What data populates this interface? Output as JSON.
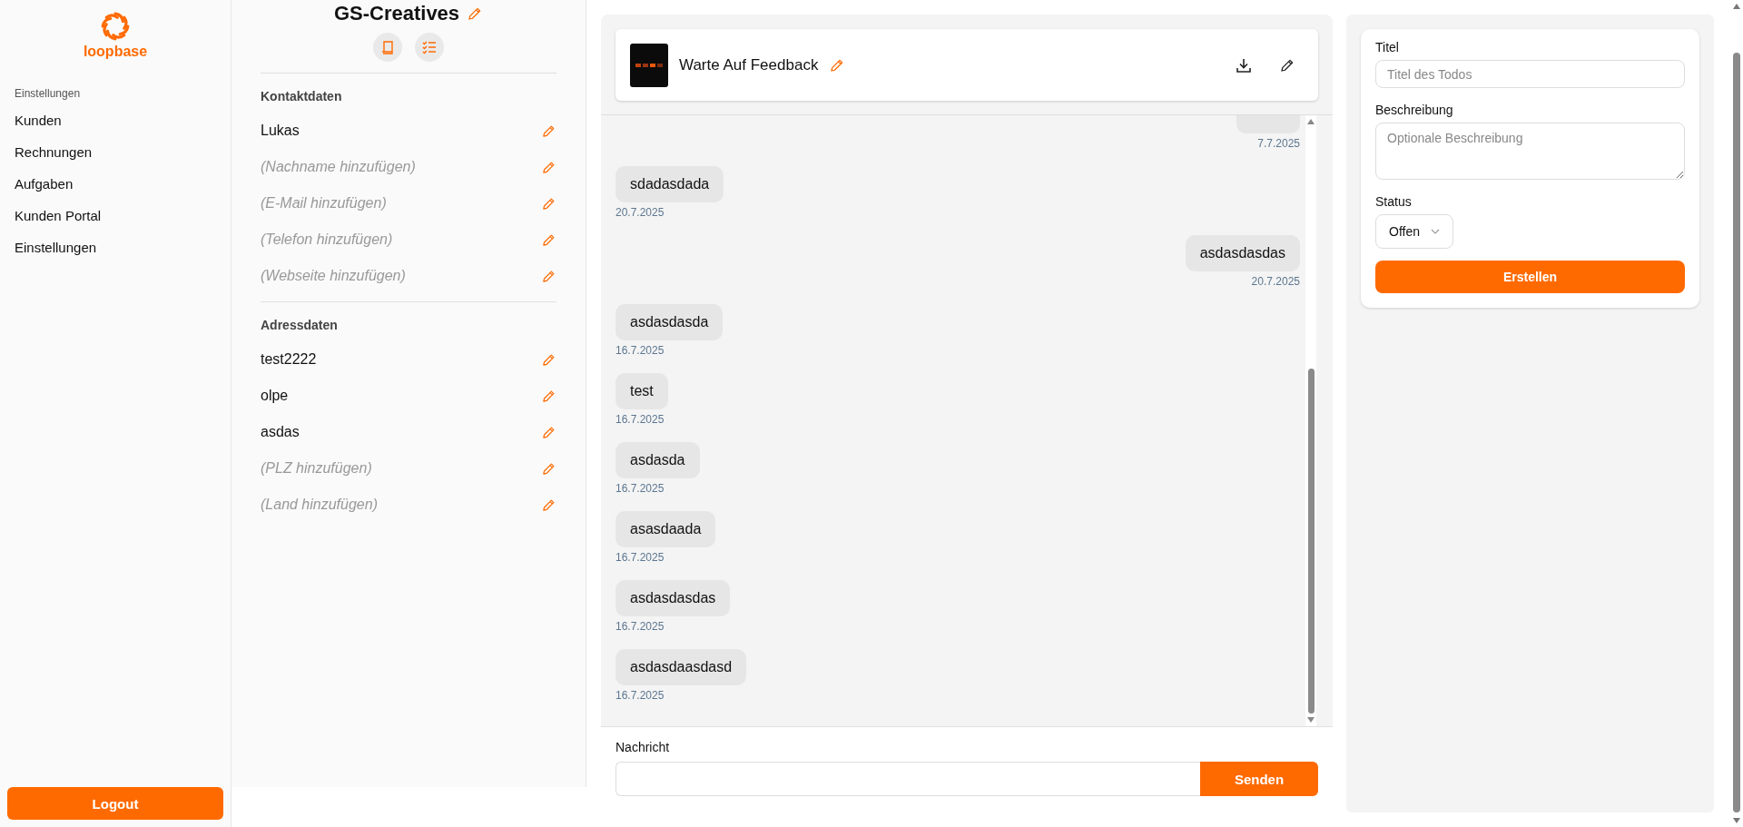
{
  "sidebar": {
    "logo_text": "loopbase",
    "section_label": "Einstellungen",
    "items": [
      {
        "label": "Kunden"
      },
      {
        "label": "Rechnungen"
      },
      {
        "label": "Aufgaben"
      },
      {
        "label": "Kunden Portal"
      },
      {
        "label": "Einstellungen"
      }
    ],
    "logout": "Logout"
  },
  "customer": {
    "name": "GS-Creatives",
    "sections": [
      {
        "title": "Kontaktdaten",
        "fields": [
          {
            "value": "Lukas",
            "missing": false
          },
          {
            "value": "(Nachname hinzufügen)",
            "missing": true
          },
          {
            "value": "(E-Mail hinzufügen)",
            "missing": true
          },
          {
            "value": "(Telefon hinzufügen)",
            "missing": true
          },
          {
            "value": "(Webseite hinzufügen)",
            "missing": true
          }
        ]
      },
      {
        "title": "Adressdaten",
        "fields": [
          {
            "value": "test2222",
            "missing": false
          },
          {
            "value": "olpe",
            "missing": false
          },
          {
            "value": "asdas",
            "missing": false
          },
          {
            "value": "(PLZ hinzufügen)",
            "missing": true
          },
          {
            "value": "(Land hinzufügen)",
            "missing": true
          }
        ]
      }
    ]
  },
  "chat": {
    "status_title": "Warte Auf Feedback",
    "messages": [
      {
        "kind": "sent",
        "date": "7.7.2025"
      },
      {
        "kind": "received",
        "text": "sdadasdada",
        "date": "20.7.2025"
      },
      {
        "kind": "sent",
        "text": "asdasdasdas",
        "date": "20.7.2025"
      },
      {
        "kind": "received",
        "text": "asdasdasda",
        "date": "16.7.2025"
      },
      {
        "kind": "received",
        "text": "test",
        "date": "16.7.2025"
      },
      {
        "kind": "received",
        "text": "asdasda",
        "date": "16.7.2025"
      },
      {
        "kind": "received",
        "text": "asasdaada",
        "date": "16.7.2025"
      },
      {
        "kind": "received",
        "text": "asdasdasdas",
        "date": "16.7.2025"
      },
      {
        "kind": "received",
        "text": "asdasdaasdasd",
        "date": "16.7.2025"
      }
    ],
    "composer": {
      "label": "Nachricht",
      "button": "Senden"
    }
  },
  "todo_form": {
    "fields": [
      {
        "kind": "input",
        "label": "Titel",
        "placeholder": "Titel des Todos"
      },
      {
        "kind": "textarea",
        "label": "Beschreibung",
        "placeholder": "Optionale Beschreibung"
      },
      {
        "kind": "select",
        "label": "Status",
        "value": "Offen"
      }
    ],
    "submit": "Erstellen"
  }
}
